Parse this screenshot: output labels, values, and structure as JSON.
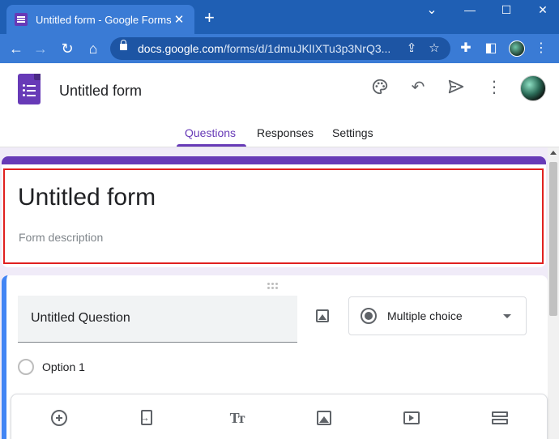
{
  "browser": {
    "tab_title": "Untitled form - Google Forms",
    "tab_close": "✕",
    "new_tab": "+",
    "window_controls": {
      "minimize": "—",
      "maximize": "☐",
      "close": "✕",
      "menu": "⌄"
    },
    "nav": {
      "back": "←",
      "forward": "→",
      "reload": "↻",
      "home": "⌂"
    },
    "url_domain": "docs.google.com",
    "url_path": "/forms/d/1dmuJKlIXTu3p3NrQ3...",
    "icons": [
      "lock-icon",
      "share-icon",
      "bookmark-star-icon",
      "extensions-puzzle-icon",
      "side-panel-icon",
      "profile-avatar-icon",
      "more-vert-icon"
    ]
  },
  "app": {
    "form_name": "Untitled form",
    "header_icons": {
      "palette": "🎨",
      "undo": "↶",
      "send": "➢",
      "more": "⋮"
    },
    "tabs": [
      {
        "label": "Questions",
        "active": true
      },
      {
        "label": "Responses",
        "active": false
      },
      {
        "label": "Settings",
        "active": false
      }
    ],
    "accent_color": "#673ab7"
  },
  "form": {
    "title": "Untitled form",
    "description_placeholder": "Form description",
    "highlight_color": "#e0201f"
  },
  "question": {
    "title": "Untitled Question",
    "type": "Multiple choice",
    "options": [
      "Option 1"
    ],
    "active_border_color": "#4285f4"
  },
  "toolbar": {
    "items": [
      "add-question",
      "import-questions",
      "add-title-and-description",
      "add-image",
      "add-video",
      "add-section"
    ],
    "text_icon": "Tт"
  }
}
